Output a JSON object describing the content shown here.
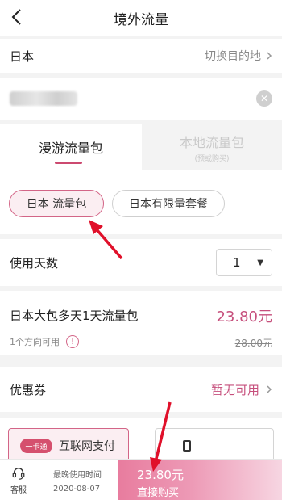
{
  "header": {
    "title": "境外流量"
  },
  "destination": {
    "country": "日本",
    "switch_label": "切换目的地"
  },
  "phone": {
    "clear_icon": "clear-icon"
  },
  "tabs": [
    {
      "label": "漫游流量包"
    },
    {
      "label": "本地流量包",
      "sublabel": "(预或购买)"
    }
  ],
  "plans": [
    {
      "label": "日本 流量包",
      "selected": true
    },
    {
      "label": "日本有限量套餐",
      "selected": false
    }
  ],
  "days": {
    "label": "使用天数",
    "value": "1"
  },
  "package": {
    "name": "日本大包多天1天流量包",
    "price": "23.80元",
    "original_price": "28.00元",
    "direction_note": "1个方向可用"
  },
  "coupon": {
    "label": "优惠券",
    "value": "暂无可用"
  },
  "payment": {
    "option_a": "互联网支付",
    "logo_text": "一卡通"
  },
  "bottom_bar": {
    "service_label": "客服",
    "cutoff_label": "最晚使用时间",
    "cutoff_date": "2020-08-07",
    "buy_price": "23.80元",
    "buy_label": "直接购买"
  },
  "colors": {
    "accent": "#c64f7c",
    "arrow": "#e0102a"
  }
}
